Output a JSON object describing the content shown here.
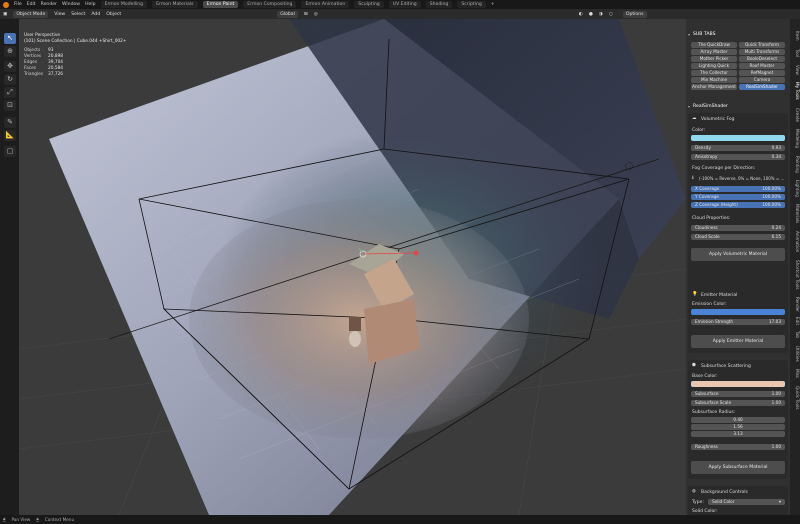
{
  "topbar": {
    "menus": [
      "File",
      "Edit",
      "Render",
      "Window",
      "Help"
    ],
    "workspaces": [
      "Ermon Modelling",
      "Ermon Materials",
      "Ermon Paint",
      "Ermon Compositing",
      "Ermon Animation",
      "Sculpting",
      "UV Editing",
      "Shading",
      "Scripting"
    ],
    "active_workspace": "Ermon Paint",
    "add_tab": "+"
  },
  "header": {
    "mode": "Object Mode",
    "menus": [
      "View",
      "Select",
      "Add",
      "Object"
    ],
    "orientation": "Global",
    "options": "Options"
  },
  "overlay": {
    "view_name": "User Perspective",
    "collection": "(101) Scene Collection | Cube.044 +Shirt_002+",
    "stats": [
      {
        "k": "Objects",
        "v": "93"
      },
      {
        "k": "Vertices",
        "v": "20,898"
      },
      {
        "k": "Edges",
        "v": "39,704"
      },
      {
        "k": "Faces",
        "v": "20,584"
      },
      {
        "k": "Triangles",
        "v": "37,726"
      }
    ]
  },
  "sidebar": {
    "subtabs": {
      "title": "SUB TABS",
      "buttons": [
        "The QuickDraw",
        "Quick Transform",
        "Array Master",
        "Multi Transforms",
        "Mother Picker",
        "BooleDeselect",
        "Lighting Quick",
        "Roof Master",
        "The Collector",
        "RefMagnet",
        "Mix Machine",
        "Camera",
        "Anchor Management",
        "RealSimShader"
      ],
      "active": "RealSimShader"
    },
    "realsim": {
      "title": "RealSimShader",
      "fog": {
        "title": "Volumetric Fog",
        "color_label": "Color:",
        "color": "#8fd8ee",
        "density_label": "Density",
        "density": "0.93",
        "anisotropy_label": "Anisotropy",
        "anisotropy": "0.34",
        "coverage_title": "Fog Coverage per Direction:",
        "coverage_hint": "(-100% = Reverse, 0% = None, 100% = ...",
        "coverages": [
          {
            "label": "X Coverage",
            "value": "100.00%"
          },
          {
            "label": "Y Coverage",
            "value": "100.00%"
          },
          {
            "label": "Z Coverage (Height)",
            "value": "100.00%"
          }
        ],
        "cloud_title": "Cloud Properties:",
        "cloudiness_label": "Cloudiness",
        "cloudiness": "0.24",
        "cloud_scale_label": "Cloud Scale",
        "cloud_scale": "6.15",
        "apply": "Apply Volumetric Material"
      },
      "emitter": {
        "title": "Emitter Material",
        "color_label": "Emission Color:",
        "color": "#4a82d6",
        "strength_label": "Emission Strength",
        "strength": "17.03",
        "apply": "Apply Emitter Material"
      },
      "sss": {
        "title": "Subsurface Scattering",
        "base_label": "Base Color:",
        "base_color": "#e8c7b3",
        "subsurface_label": "Subsurface",
        "subsurface": "1.00",
        "scale_label": "Subsurface Scale",
        "scale": "1.00",
        "radius_label": "Subsurface Radius:",
        "radius": [
          "0.40",
          "1.56",
          "3.13"
        ],
        "roughness_label": "Roughness",
        "roughness": "1.00",
        "apply": "Apply Subsurface Material"
      },
      "background": {
        "title": "Background Controls",
        "type_label": "Type:",
        "type_value": "Solid Color",
        "solid_label": "Solid Color:"
      }
    },
    "vertical_tabs": [
      "Item",
      "Tool",
      "View",
      "My Tools",
      "Create",
      "Modeling",
      "Painting",
      "Lighting",
      "Materials",
      "Animation",
      "Shortcut Tools",
      "Render",
      "Edit",
      "Tab",
      "Utilities",
      "Misc",
      "Quick Tools"
    ]
  },
  "statusbar": {
    "items": [
      "Pan View",
      "Context Menu"
    ]
  }
}
